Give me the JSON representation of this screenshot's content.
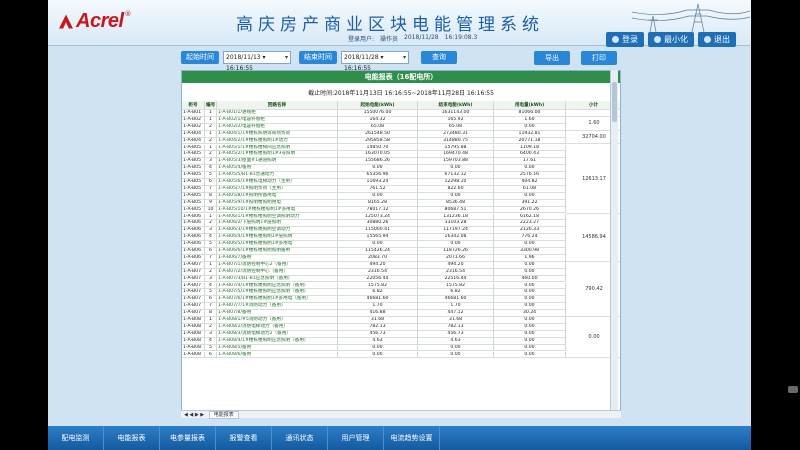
{
  "header": {
    "logo_text": "Acrel",
    "logo_reg": "®",
    "title": "高庆房产商业区块电能管理系统",
    "user_label": "登录用户:",
    "user_name": "操作员",
    "date": "2018/11/28",
    "time": "16:19:08.3",
    "buttons": [
      {
        "label": "登录",
        "icon": "user-icon"
      },
      {
        "label": "最小化",
        "icon": "minimize-icon"
      },
      {
        "label": "退出",
        "icon": "exit-icon"
      }
    ]
  },
  "query": {
    "start_label": "起始时间",
    "start_value": "2018/11/13 ▾ 16:16:55",
    "end_label": "结束时间",
    "end_value": "2018/11/28 ▾ 16:16:55",
    "query_btn": "查询",
    "export_btn": "导出",
    "print_btn": "打印"
  },
  "report": {
    "title": "电能报表（16配电所）",
    "range": "截止时间:2018年11月13日 16:16:55~2018年11月28日 16:16:55",
    "columns": [
      "柜号",
      "编号",
      "回路名称",
      "起始电能(kWh)",
      "结束电能(kWh)",
      "用电量(kWh)",
      "小计"
    ],
    "rows": [
      [
        "1-A-B01",
        "1",
        "1-A-B01/1/进线柜",
        "1550076.00",
        "1631143.00",
        "81066.00"
      ],
      [
        "1-A-B02",
        "1",
        "1-A-B02/1/电容补偿柜",
        "164.32",
        "165.92",
        "1.60"
      ],
      [
        "1-A-B02",
        "2",
        "1-A-B02/2/电容补偿柜",
        "65.08",
        "65.08",
        "0.00"
      ],
      [
        "1-A-B04",
        "1",
        "1-A-B04/1/1#楼栋照明等商场负荷",
        "261548.50",
        "273480.31",
        "11932.81"
      ],
      [
        "1-A-B04",
        "2",
        "1-A-B04/2/1#楼栋楼照明1#动力",
        "295858.58",
        "314880.75",
        "20771.18"
      ],
      [
        "1-A-B05",
        "1",
        "1-A-B05/1/1#楼栋楼梯间应急照明",
        "14850.70",
        "15795.88",
        "1109.18"
      ],
      [
        "1-A-B05",
        "2",
        "1-A-B05/2/1#楼栋楼照明1#3号照明",
        "163070.05",
        "169470.48",
        "6400.43"
      ],
      [
        "1-A-B05",
        "3",
        "1-A-B05/3/屋面#1通道照明",
        "155686.26",
        "159703.88",
        "17.61"
      ],
      [
        "1-A-B05",
        "4",
        "1-A-B05/4/备用",
        "0.00",
        "0.00",
        "0.00"
      ],
      [
        "1-A-B05",
        "5",
        "1-A-B05/5/B1-B1普通动力",
        "65356.96",
        "67132.12",
        "2576.16"
      ],
      [
        "1-A-B05",
        "6",
        "1-A-B05/6/1#楼栋电梯动力（主用）",
        "11693.24",
        "12298.10",
        "404.82"
      ],
      [
        "1-A-B05",
        "7",
        "1-A-B05/7/1#照明负荷（主用）",
        "761.52",
        "822.60",
        "61.08"
      ],
      [
        "1-A-B05",
        "8",
        "1-A-B05/8/1#照明所备用电",
        "0.00",
        "0.00",
        "0.00"
      ],
      [
        "1-A-B05",
        "9",
        "1-A-B05/9/1#照明楼照明用电",
        "8165.28",
        "8536.48",
        "391.22"
      ],
      [
        "1-A-B05",
        "10",
        "1-A-B05/10/1#楼栋楼照明1#多用电",
        "78017.12",
        "80687.51",
        "2670.26"
      ],
      [
        "1-A-B06",
        "1",
        "1-A-B06/1/1#楼栋楼照明空调照明动力",
        "125073.24",
        "131236.18",
        "6162.18"
      ],
      [
        "1-A-B06",
        "2",
        "1-A-B06/2/下层照明1#层照明",
        "30880.26",
        "33103.28",
        "2223.27"
      ],
      [
        "1-A-B06",
        "3",
        "1-A-B06/3/1#楼栋楼照明空调动力",
        "115000.41",
        "117197.24",
        "2126.33"
      ],
      [
        "1-A-B06",
        "4",
        "1-A-B06/4/1#楼栋楼照明1#层照明",
        "15565.94",
        "16342.08",
        "776.24"
      ],
      [
        "1-A-B06",
        "5",
        "1-A-B06/5/1#楼栋楼照明1#多用电",
        "0.00",
        "0.00",
        "0.00"
      ],
      [
        "1-A-B06",
        "6",
        "1-A-B06/6/1#楼栋楼照明照明备用",
        "115426.24",
        "118726.26",
        "3300.98"
      ],
      [
        "1-A-B06",
        "7",
        "1-A-B06/7/备用",
        "2083.70",
        "2071.66",
        "1.96"
      ],
      [
        "1-A-B07",
        "1",
        "1-A-B07/1/消防控制中心2（备用）",
        "494.20",
        "494.20",
        "0.00"
      ],
      [
        "1-A-B07",
        "2",
        "1-A-B07/2/消防控制中心（备用）",
        "2316.54",
        "2316.54",
        "0.00"
      ],
      [
        "1-A-B07",
        "3",
        "1-A-B07/3/B1-B1应急照明（备用）",
        "22056.44",
        "22516.44",
        "460.00"
      ],
      [
        "1-A-B07",
        "4",
        "1-A-B07/4/1#楼栋楼照明应急照明（备用）",
        "1575.82",
        "1575.82",
        "0.00"
      ],
      [
        "1-A-B07",
        "5",
        "1-A-B07/5/1#楼栋楼照明应急照明（备用）",
        "6.82",
        "6.82",
        "0.00"
      ],
      [
        "1-A-B07",
        "6",
        "1-A-B07/6/1#楼栋楼照明1#多用电（备用）",
        "46681.60",
        "46681.60",
        "0.00"
      ],
      [
        "1-A-B07",
        "7",
        "1-A-B07/7/1#消防动力（备用）",
        "1.70",
        "1.70",
        "0.00"
      ],
      [
        "1-A-B07",
        "8",
        "1-A-B07/8/备用",
        "416.88",
        "447.12",
        "30.24"
      ],
      [
        "1-A-B08",
        "1",
        "1-A-B08/1/#5消防动力（备用）",
        "31.68",
        "31.68",
        "0.00"
      ],
      [
        "1-A-B08",
        "2",
        "1-A-B08/2/消防电梯动力（备用）",
        "782.13",
        "782.13",
        "0.00"
      ],
      [
        "1-A-B08",
        "3",
        "1-A-B08/3/消防电梯动力2（备用）",
        "456.73",
        "456.73",
        "0.00"
      ],
      [
        "1-A-B08",
        "4",
        "1-A-B08/4/1#楼栋楼照明应急照明（备用）",
        "4.63",
        "4.63",
        "0.00"
      ],
      [
        "1-A-B08",
        "5",
        "1-A-B08/5/备用",
        "0.00",
        "0.00",
        "0.00"
      ],
      [
        "1-A-B08",
        "6",
        "1-A-B08/6/备用",
        "0.00",
        "0.00",
        "0.00"
      ]
    ],
    "subtotals": [
      {
        "label": "",
        "from": 0,
        "to": 1
      },
      {
        "label": "1.60",
        "from": 1,
        "to": 3
      },
      {
        "label": "32704.00",
        "from": 3,
        "to": 5
      },
      {
        "label": "12613.17",
        "from": 5,
        "to": 15
      },
      {
        "label": "14586.94",
        "from": 15,
        "to": 22
      },
      {
        "label": "790.42",
        "from": 22,
        "to": 30
      },
      {
        "label": "0.00",
        "from": 30,
        "to": 36
      }
    ],
    "sheet_tab": "电能报表"
  },
  "nav": [
    "配电监测",
    "电能报表",
    "电参量报表",
    "报警查看",
    "通讯状态",
    "用户管理",
    "电流趋势设置"
  ]
}
